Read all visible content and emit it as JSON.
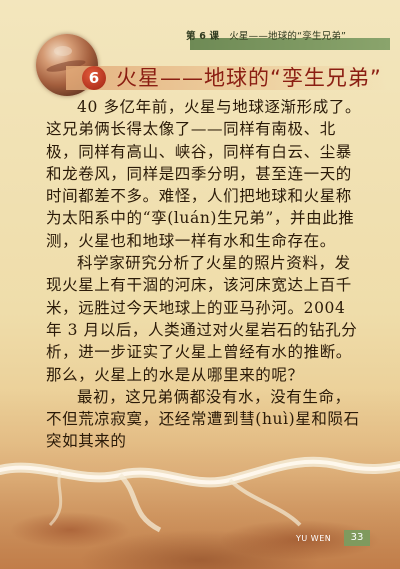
{
  "header": {
    "lesson_label": "第 6 课",
    "lesson_title": "火星——地球的“孪生兄弟”"
  },
  "title": {
    "number": "6",
    "text": "火星——地球的“孪生兄弟”"
  },
  "paragraphs": [
    "40 多亿年前，火星与地球逐渐形成了。这兄弟俩长得太像了——同样有南极、北极，同样有高山、峡谷，同样有白云、尘暴和龙卷风，同样是四季分明，甚至连一天的时间都差不多。难怪，人们把地球和火星称为太阳系中的“孪(luán)生兄弟”，并由此推测，火星也和地球一样有水和生命存在。",
    "科学家研究分析了火星的照片资料，发现火星上有干涸的河床，该河床宽达上百千米，远胜过今天地球上的亚马孙河。2004 年 3 月以后，人类通过对火星岩石的钻孔分析，进一步证实了火星上曾经有水的推断。那么，火星上的水是从哪里来的呢？",
    "最初，这兄弟俩都没有水，没有生命，不但荒凉寂寞，还经常遭到彗(huì)星和陨石突如其来的"
  ],
  "footer": {
    "label": "YU WEN",
    "page_number": "33"
  }
}
